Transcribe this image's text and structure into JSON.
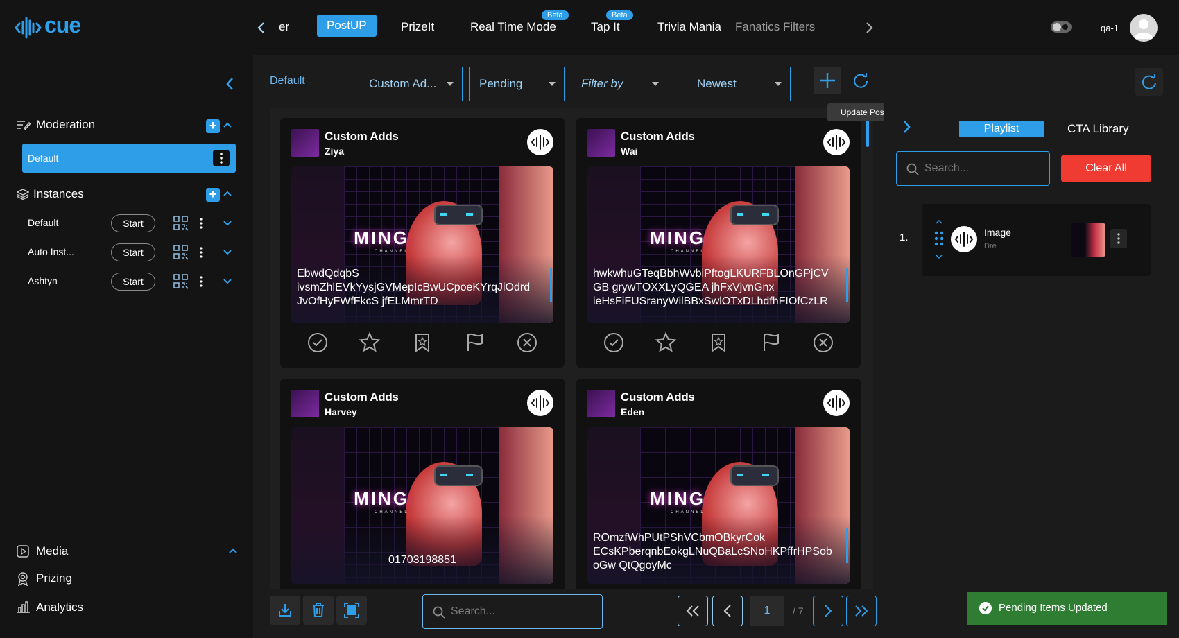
{
  "app": {
    "logo_text": "cue",
    "brand_color": "#2f9ee8"
  },
  "topnav": {
    "items": [
      {
        "label": "er",
        "active": false
      },
      {
        "label": "PostUP",
        "active": true
      },
      {
        "label": "PrizeIt",
        "active": false
      },
      {
        "label": "Real Time Mode",
        "active": false,
        "badge": "Beta"
      },
      {
        "label": "Tap It",
        "active": false,
        "badge": "Beta"
      },
      {
        "label": "Trivia Mania",
        "active": false
      },
      {
        "label": "Fanatics Filters",
        "active": false
      }
    ],
    "user": "qa-1"
  },
  "sidebar": {
    "moderation": {
      "title": "Moderation",
      "selected": "Default"
    },
    "instances": {
      "title": "Instances",
      "items": [
        {
          "name": "Default",
          "button": "Start"
        },
        {
          "name": "Auto Inst...",
          "button": "Start"
        },
        {
          "name": "Ashtyn",
          "button": "Start"
        }
      ]
    },
    "bottom": [
      {
        "label": "Media",
        "icon": "media-icon"
      },
      {
        "label": "Prizing",
        "icon": "prize-icon"
      },
      {
        "label": "Analytics",
        "icon": "analytics-icon"
      }
    ]
  },
  "toolbar": {
    "breadcrumb": "Default",
    "filters": [
      "Custom Ad...",
      "Pending",
      "Filter by",
      "Newest"
    ],
    "tooltip": "Update Posts"
  },
  "posts": [
    {
      "category": "Custom Adds",
      "user": "Ziya",
      "text": [
        "EbwdQdqbS",
        "ivsmZhlEVkYysjGVMepIcBwUCpoeKYrqJiOdrd",
        "JvOfHyFWfFkcS jfELMmrTD"
      ]
    },
    {
      "category": "Custom Adds",
      "user": "Wai",
      "text": [
        "hwkwhuGTeqBbhWvbiPftogLKURFBLOnGPjCV",
        "GB grywTOXXLyQGEA jhFxVjvnGnx",
        "ieHsFiFUSranyWilBBxSwlOTxDLhdfhFIOfCzLR"
      ]
    },
    {
      "category": "Custom Adds",
      "user": "Harvey",
      "text": [
        "01703198851"
      ]
    },
    {
      "category": "Custom Adds",
      "user": "Eden",
      "text": [
        "ROmzfWhPUtPShVCbmOBkyrCok",
        "ECsKPberqnbEokgLNuQBaLcSNoHKPffrHPSob",
        "oGw QtQgoyMc"
      ]
    }
  ],
  "media_overlay": {
    "headline": "MING",
    "sub": "CHANNEL"
  },
  "bottom_bar": {
    "search_placeholder": "Search...",
    "page": "1",
    "total": "/ 7"
  },
  "right_panel": {
    "tabs": [
      "Playlist",
      "CTA Library"
    ],
    "search_placeholder": "Search...",
    "clear_label": "Clear All",
    "playlist": [
      {
        "index": "1.",
        "title": "Image",
        "subtitle": "Dre"
      }
    ]
  },
  "toast": {
    "message": "Pending Items Updated",
    "color": "#2e7d32"
  }
}
